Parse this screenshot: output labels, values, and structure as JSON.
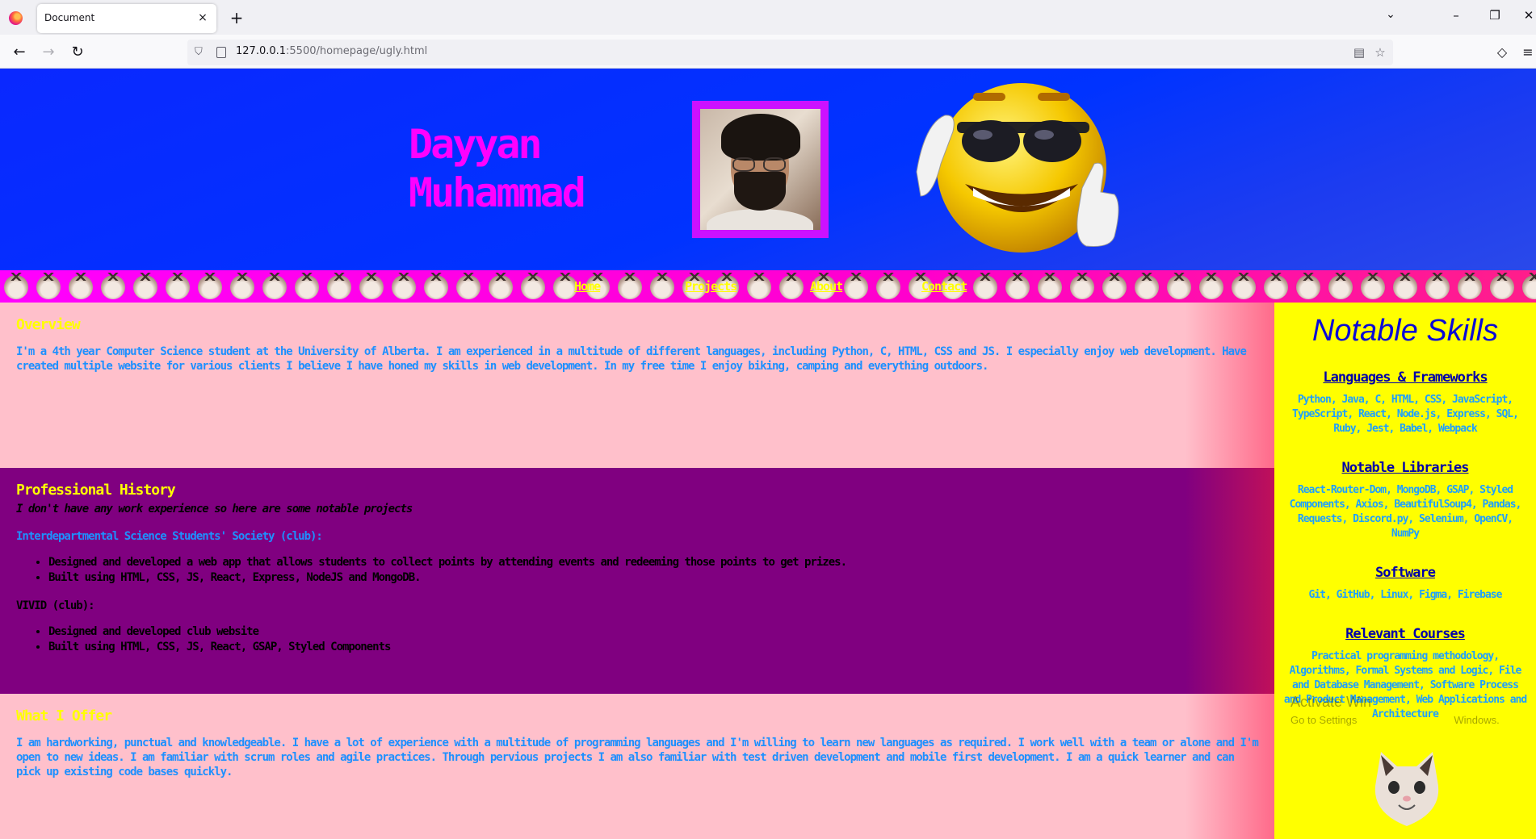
{
  "browser": {
    "tab_title": "Document",
    "tab_close": "×",
    "new_tab": "+",
    "url_host": "127.0.0.1",
    "url_rest": ":5500/homepage/ugly.html"
  },
  "header": {
    "first_name": "Dayyan",
    "last_name": "Muhammad"
  },
  "nav": {
    "links": [
      "Home",
      "Projects",
      "About",
      "Contact"
    ]
  },
  "overview": {
    "title": "Overview",
    "text": "I'm a 4th year Computer Science student at the University of Alberta. I am experienced in a multitude of different languages, including Python, C, HTML, CSS and JS. I especially enjoy web development. Have created multiple website for various clients I believe I have honed my skills in web development. In my free time I enjoy biking, camping and everything outdoors."
  },
  "history": {
    "title": "Professional History",
    "subtitle": "I don't have any work experience so here are some notable projects",
    "clubs": [
      {
        "name": "Interdepartmental Science Students' Society (club):",
        "items": [
          "Designed and developed a web app that allows students to collect points by attending events and redeeming those points to get prizes.",
          "Built using HTML, CSS, JS, React, Express, NodeJS and MongoDB."
        ]
      },
      {
        "name": "VIVID (club):",
        "items": [
          "Designed and developed club website",
          "Built using HTML, CSS, JS, React, GSAP, Styled Components"
        ]
      }
    ]
  },
  "offer": {
    "title": "What I Offer",
    "text": "I am hardworking, punctual and knowledgeable. I have a lot of experience with a multitude of programming languages and I'm willing to learn new languages as required. I work well with a team or alone and I'm open to new ideas. I am familiar with scrum roles and agile practices. Through pervious projects I am also familiar with test driven development and mobile first development. I am a quick learner and can pick up existing code bases quickly."
  },
  "skills": {
    "title": "Notable Skills",
    "groups": [
      {
        "heading": "Languages & Frameworks",
        "body": "Python, Java, C, HTML, CSS, JavaScript, TypeScript, React, Node.js, Express, SQL, Ruby, Jest, Babel, Webpack"
      },
      {
        "heading": "Notable Libraries",
        "body": "React-Router-Dom, MongoDB, GSAP, Styled Components, Axios, BeautifulSoup4, Pandas, Requests, Discord.py, Selenium, OpenCV, NumPy"
      },
      {
        "heading": "Software",
        "body": "Git, GitHub, Linux, Figma, Firebase"
      },
      {
        "heading": "Relevant Courses",
        "body": "Practical programming methodology, Algorithms, Formal Systems and Logic, File and Database Management, Software Process and Product Management, Web Applications and Architecture"
      }
    ]
  },
  "watermark": {
    "title": "Activate Win",
    "sub": "Go to Settings",
    "sub_tail": "Windows."
  },
  "colors": {
    "header_bg": "#0033ff",
    "name": "#ff00ff",
    "nav_bg": "#ff00ff",
    "nav_link": "#ffff00",
    "section_pink": "#ffc0cb",
    "section_purple": "#800080",
    "aside_bg": "#ffff00",
    "text_blue": "#1e90ff"
  }
}
